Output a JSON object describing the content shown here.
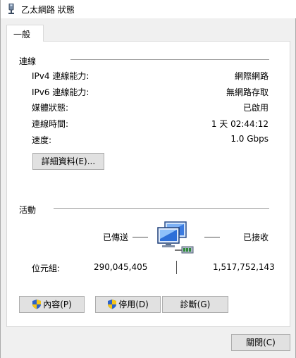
{
  "window": {
    "title": "乙太網路 狀態"
  },
  "tabs": [
    {
      "label": "一般"
    }
  ],
  "connection": {
    "heading": "連線",
    "rows": [
      {
        "label": "IPv4 連線能力:",
        "value": "網際網路"
      },
      {
        "label": "IPv6 連線能力:",
        "value": "無網路存取"
      },
      {
        "label": "媒體狀態:",
        "value": "已啟用"
      },
      {
        "label": "連線時間:",
        "value": "1 天 02:44:12"
      },
      {
        "label": "速度:",
        "value": "1.0 Gbps"
      }
    ],
    "details_button": "詳細資料(E)..."
  },
  "activity": {
    "heading": "活動",
    "sent_label": "已傳送",
    "received_label": "已接收",
    "bytes_label": "位元組:",
    "bytes_sent": "290,045,405",
    "bytes_received": "1,517,752,143"
  },
  "buttons": {
    "properties": "內容(P)",
    "disable": "停用(D)",
    "diagnose": "診斷(G)",
    "close": "關閉(C)"
  },
  "icons": {
    "title": "network-adapter-icon",
    "network": "network-computers-icon",
    "shield": "uac-shield-icon"
  },
  "colors": {
    "window_bg": "#f0f0f0",
    "panel_bg": "#ffffff",
    "button_bg": "#e1e1e1",
    "button_border": "#adadad"
  }
}
